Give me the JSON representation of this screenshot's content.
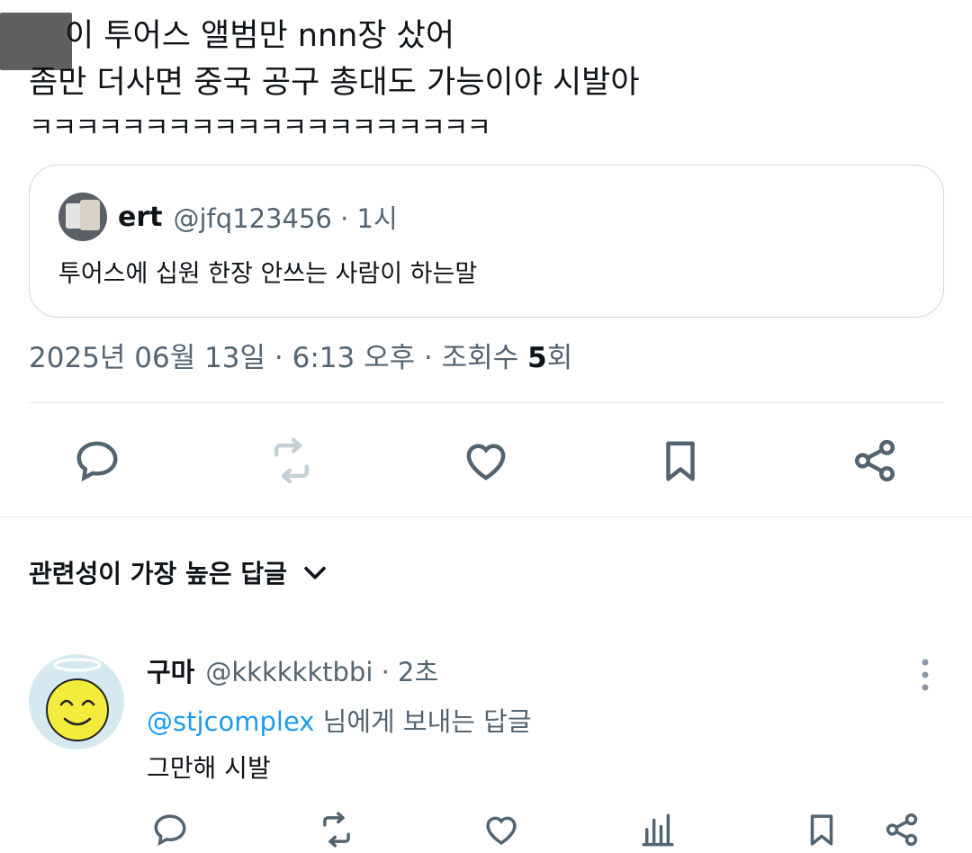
{
  "tweet": {
    "line1": "이 투어스 앨범만 nnn장 샀어",
    "line2": "좀만 더사면 중국 공구 총대도 가능이야 시발아",
    "line3": "ㅋㅋㅋㅋㅋㅋㅋㅋㅋㅋㅋㅋㅋㅋㅋㅋㅋㅋㅋㅋ"
  },
  "quote": {
    "name": "ert",
    "handle_time": "@jfq123456 · 1시",
    "body": "투어스에 십원 한장 안쓰는 사람이 하는말"
  },
  "meta": {
    "timestamp": "2025년 06월 13일 · 6:13 오후 · 조회수 ",
    "views": "5",
    "views_unit": "회"
  },
  "actions": {
    "reply_icon": "reply-icon",
    "retweet_icon": "retweet-icon",
    "like_icon": "heart-icon",
    "bookmark_icon": "bookmark-icon",
    "share_icon": "share-icon"
  },
  "sort": {
    "label": "관련성이 가장 높은 답글"
  },
  "reply": {
    "name": "구마",
    "handle_time": "@kkkkkktbbi · 2초",
    "mention": "@stjcomplex",
    "replying_suffix": " 님에게 보내는 답글",
    "body": "그만해 시발"
  },
  "colors": {
    "text": "#0f1419",
    "secondary": "#536471",
    "link": "#1d9bf0",
    "border": "#cfd9de",
    "retweet_disabled": "#c4cfd6"
  }
}
